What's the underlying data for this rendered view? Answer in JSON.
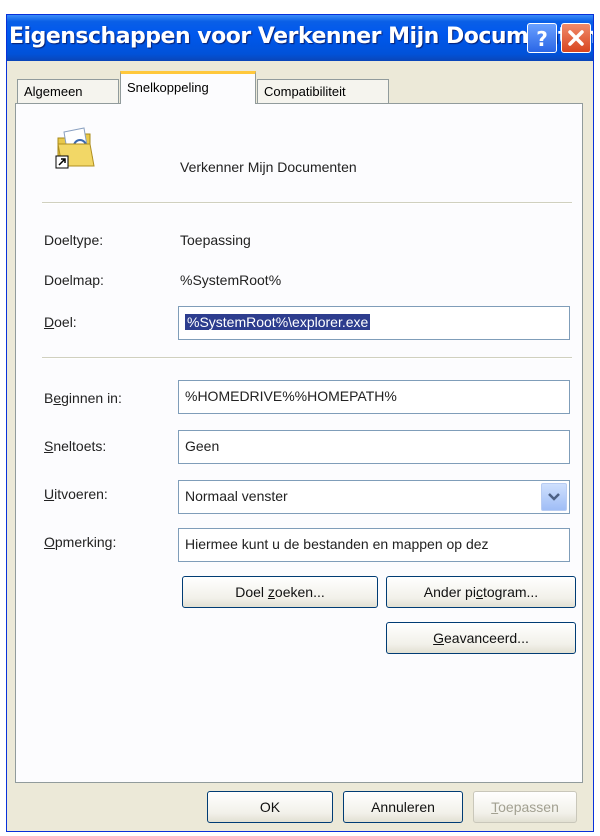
{
  "window": {
    "title": "Eigenschappen voor Verkenner  Mijn Documenten",
    "help_glyph": "?",
    "close_glyph": "x"
  },
  "tabs": [
    {
      "label": "Algemeen",
      "active": false
    },
    {
      "label": "Snelkoppeling",
      "active": true
    },
    {
      "label": "Compatibiliteit",
      "active": false
    }
  ],
  "shortcut": {
    "icon": "folder-shortcut-icon",
    "name": "Verkenner  Mijn Documenten"
  },
  "fields": {
    "doeltype_label": "Doeltype:",
    "doeltype_value": "Toepassing",
    "doelmap_label": "Doelmap:",
    "doelmap_value": "%SystemRoot%",
    "doel_label_acc": "D",
    "doel_label_rest": "oel:",
    "doel_value": "%SystemRoot%\\explorer.exe",
    "beginnen_label_pre": "B",
    "beginnen_label_acc": "e",
    "beginnen_label_rest": "ginnen in:",
    "beginnen_value": "%HOMEDRIVE%%HOMEPATH%",
    "sneltoets_label_acc": "S",
    "sneltoets_label_rest": "neltoets:",
    "sneltoets_value": "Geen",
    "uitvoeren_label_acc": "U",
    "uitvoeren_label_rest": "itvoeren:",
    "uitvoeren_value": "Normaal venster",
    "opmerking_label_acc": "O",
    "opmerking_label_rest": "pmerking:",
    "opmerking_value": "Hiermee kunt u de bestanden en mappen op dez"
  },
  "buttons": {
    "doel_zoeken_pre": "Doel ",
    "doel_zoeken_acc": "z",
    "doel_zoeken_rest": "oeken...",
    "ander_pre": "Ander pi",
    "ander_acc": "c",
    "ander_rest": "togram...",
    "geavanceerd_acc": "G",
    "geavanceerd_rest": "eavanceerd...",
    "ok": "OK",
    "annuleren": "Annuleren",
    "toepassen_acc": "T",
    "toepassen_rest": "oepassen"
  },
  "colors": {
    "titlebar": "#0058ee",
    "selection": "#2d3d8e",
    "tab_highlight": "#ffc83c"
  }
}
